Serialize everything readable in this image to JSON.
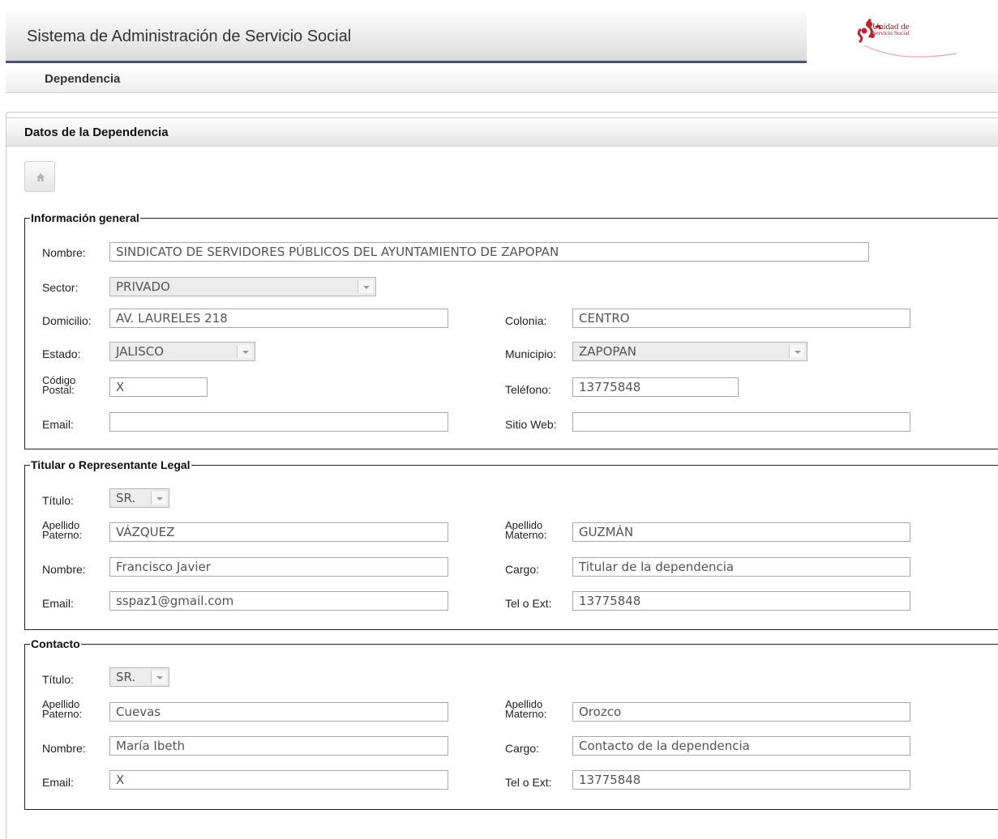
{
  "header": {
    "title": "Sistema de Administración de Servicio Social",
    "logo_line1": "Unidad de",
    "logo_line2": "Servicio Social"
  },
  "nav": {
    "item": "Dependencia"
  },
  "panel": {
    "title": "Datos de la Dependencia",
    "home_icon": "home-icon"
  },
  "general": {
    "legend": "Información general",
    "nombre_label": "Nombre:",
    "nombre_value": "SINDICATO DE SERVIDORES PÚBLICOS DEL AYUNTAMIENTO DE ZAPOPAN",
    "sector_label": "Sector:",
    "sector_value": "PRIVADO",
    "domicilio_label": "Domicilio:",
    "domicilio_value": "AV. LAURELES 218",
    "colonia_label": "Colonia:",
    "colonia_value": "CENTRO",
    "estado_label": "Estado:",
    "estado_value": "JALISCO",
    "municipio_label": "Municipio:",
    "municipio_value": "ZAPOPAN",
    "cp_label_1": "Código",
    "cp_label_2": "Postal:",
    "cp_value": "X",
    "telefono_label": "Teléfono:",
    "telefono_value": "13775848",
    "email_label": "Email:",
    "email_value": "",
    "web_label": "Sitio Web:",
    "web_value": ""
  },
  "titular": {
    "legend": "Titular o Representante Legal",
    "titulo_label": "Título:",
    "titulo_value": "SR.",
    "ap_pat_label_1": "Apellido",
    "ap_pat_label_2": "Paterno:",
    "ap_pat_value": "VÁZQUEZ",
    "ap_mat_label_1": "Apellido",
    "ap_mat_label_2": "Materno:",
    "ap_mat_value": "GUZMÁN",
    "nombre_label": "Nombre:",
    "nombre_value": "Francisco Javier",
    "cargo_label": "Cargo:",
    "cargo_value": "Titular de la dependencia",
    "email_label": "Email:",
    "email_value": "sspaz1@gmail.com",
    "tel_label": "Tel o Ext:",
    "tel_value": "13775848"
  },
  "contacto": {
    "legend": "Contacto",
    "titulo_label": "Título:",
    "titulo_value": "SR.",
    "ap_pat_label_1": "Apellido",
    "ap_pat_label_2": "Paterno:",
    "ap_pat_value": "Cuevas",
    "ap_mat_label_1": "Apellido",
    "ap_mat_label_2": "Materno:",
    "ap_mat_value": "Orozco",
    "nombre_label": "Nombre:",
    "nombre_value": " María Ibeth",
    "cargo_label": "Cargo:",
    "cargo_value": "Contacto de la dependencia",
    "email_label": "Email:",
    "email_value": "X",
    "tel_label": "Tel o Ext:",
    "tel_value": "13775848"
  }
}
